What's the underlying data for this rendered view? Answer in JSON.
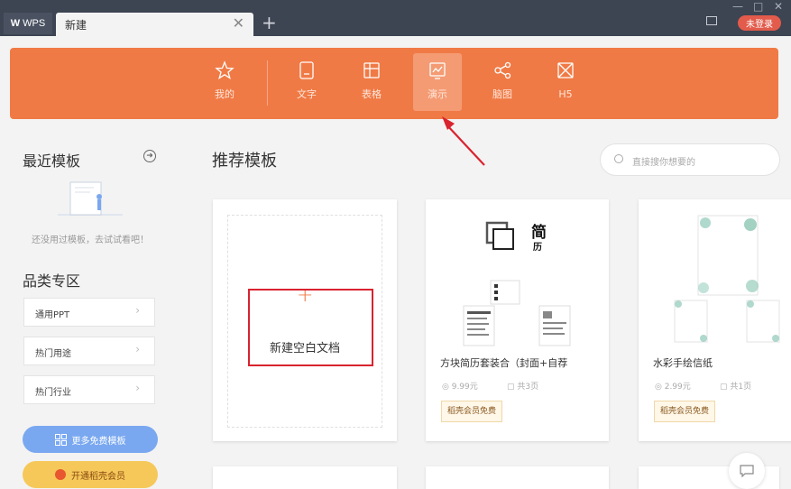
{
  "titlebar": {
    "app_tab_label": "WPS",
    "doc_tab_label": "新建",
    "close_glyph": "✕",
    "add_tab_glyph": "+",
    "login_label": "未登录"
  },
  "nav": {
    "items": [
      {
        "label": "我的",
        "icon": "star-icon"
      },
      {
        "label": "文字",
        "icon": "document-icon"
      },
      {
        "label": "表格",
        "icon": "table-icon"
      },
      {
        "label": "演示",
        "icon": "presentation-icon",
        "active": true
      },
      {
        "label": "脑图",
        "icon": "mindmap-icon"
      },
      {
        "label": "H5",
        "icon": "h5-icon"
      }
    ]
  },
  "sidebar": {
    "recent_title": "最近模板",
    "empty_text": "还没用过模板，去试试看吧！",
    "category_title": "品类专区",
    "categories": [
      "通用PPT",
      "热门用途",
      "热门行业"
    ],
    "more_free_label": "更多免费模板",
    "vip_label": "开通稻壳会员"
  },
  "main": {
    "title": "推荐模板",
    "search_placeholder": "直接搜你想要的",
    "blank_label": "新建空白文档",
    "templates": [
      {
        "name": "方块简历套装合（封面+自荐",
        "price": "9.99元",
        "pages": "共3页",
        "badge": "稻壳会员免费"
      },
      {
        "name": "水彩手绘信纸",
        "price": "2.99元",
        "pages": "共1页",
        "badge": "稻壳会员免费"
      }
    ],
    "resume_big": "简",
    "resume_small": "历"
  },
  "colors": {
    "accent": "#f07a45",
    "titlebar": "#3d4452",
    "highlight": "#d9232f"
  }
}
